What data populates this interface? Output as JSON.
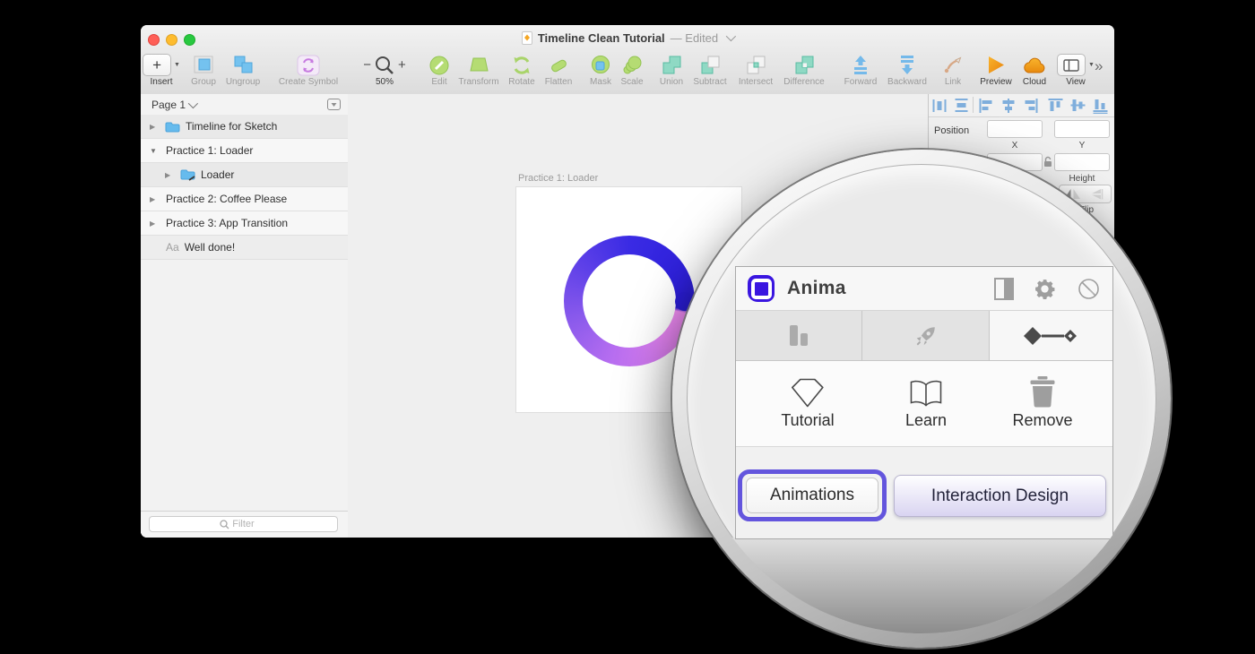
{
  "window": {
    "title": "Timeline Clean Tutorial",
    "status": "— Edited",
    "overflow_glyph": "»"
  },
  "toolbar": {
    "insert_plus": "+",
    "zoom_out": "−",
    "zoom_in": "+",
    "items": [
      {
        "label": "Insert"
      },
      {
        "label": "Group"
      },
      {
        "label": "Ungroup"
      },
      {
        "label": "Create Symbol"
      },
      {
        "label": "50%"
      },
      {
        "label": "Edit"
      },
      {
        "label": "Transform"
      },
      {
        "label": "Rotate"
      },
      {
        "label": "Flatten"
      },
      {
        "label": "Mask"
      },
      {
        "label": "Scale"
      },
      {
        "label": "Union"
      },
      {
        "label": "Subtract"
      },
      {
        "label": "Intersect"
      },
      {
        "label": "Difference"
      },
      {
        "label": "Forward"
      },
      {
        "label": "Backward"
      },
      {
        "label": "Link"
      },
      {
        "label": "Preview"
      },
      {
        "label": "Cloud"
      },
      {
        "label": "View"
      }
    ]
  },
  "sidebar": {
    "page_label": "Page 1",
    "rows": [
      {
        "label": "Timeline for Sketch",
        "disclosure": "▶"
      },
      {
        "label": "Practice 1: Loader",
        "disclosure": "▼"
      },
      {
        "label": "Loader",
        "disclosure": "▶"
      },
      {
        "label": "Practice 2: Coffee Please",
        "disclosure": "▶"
      },
      {
        "label": "Practice 3: App Transition",
        "disclosure": "▶"
      },
      {
        "label": "Well done!",
        "disclosure": "",
        "icon_text": "Aa"
      }
    ],
    "filter_placeholder": "Filter"
  },
  "canvas": {
    "artboard_label": "Practice 1: Loader"
  },
  "inspector": {
    "position_label": "Position",
    "x_label": "X",
    "y_label": "Y",
    "height_label": "Height",
    "flip_label": "Flip"
  },
  "anima": {
    "title": "Anima",
    "actions": [
      {
        "label": "Tutorial"
      },
      {
        "label": "Learn"
      },
      {
        "label": "Remove"
      }
    ],
    "primary_button": "Animations",
    "secondary_button": "Interaction Design"
  },
  "colors": {
    "anima_accent": "#6355DD",
    "anima_logo_blue": "#3A16E0",
    "loader_blue": "#3A2BE4",
    "loader_cap_blue": "#2A1CD4",
    "loader_pink": "#F18CF3",
    "loader_purple": "#8A5AEC",
    "folder_blue": "#66BBED",
    "boolean_teal": "#8FD9C4",
    "shape_green": "#B5DC73",
    "arrange_blue": "#74B9EA",
    "preview_orange": "#F49A1C",
    "traffic_red": "#FF5F57",
    "traffic_yellow": "#FEBC2E",
    "traffic_green": "#28C840"
  }
}
